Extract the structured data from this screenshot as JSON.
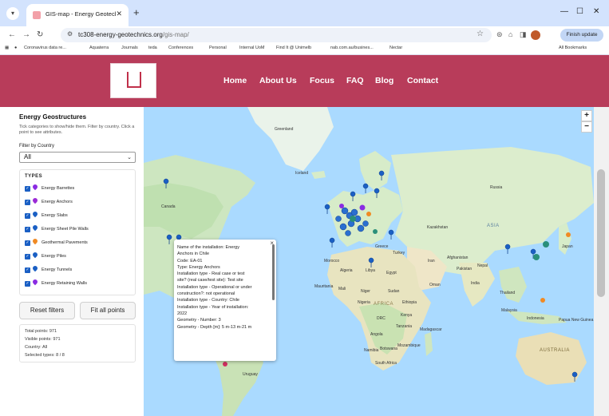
{
  "browser": {
    "tab_title": "GIS-map - Energy Geotechnics",
    "url_host": "tc308-energy-geotechnics.org",
    "url_path": "/gis-map/",
    "finish_update_label": "Finish update",
    "bookmarks": [
      "Coronavirus data re...",
      "Aquaterra",
      "Journals",
      "teda",
      "Conferences",
      "Personal",
      "Internal UoM",
      "Find It @ Unimelb",
      "nab.com.au/busines...",
      "Nectar"
    ],
    "all_bookmarks_label": "All Bookmarks"
  },
  "site": {
    "nav": [
      "Home",
      "About Us",
      "Focus",
      "FAQ",
      "Blog",
      "Contact"
    ],
    "header_color": "#b83c5a"
  },
  "sidebar": {
    "title": "Energy Geostructures",
    "help": "Tick categories to show/hide them. Filter by country. Click a point to see attributes.",
    "filter_label": "Filter by Country",
    "filter_value": "All",
    "types_heading": "TYPES",
    "types": [
      {
        "label": "Energy Barrettes",
        "color": "#8a2be2"
      },
      {
        "label": "Energy Anchors",
        "color": "#9b2bd6"
      },
      {
        "label": "Energy Slabs",
        "color": "#1a5fc4"
      },
      {
        "label": "Energy Sheet Pile Walls",
        "color": "#1a5fc4"
      },
      {
        "label": "Geothermal Pavements",
        "color": "#f08a24"
      },
      {
        "label": "Energy Piles",
        "color": "#1a5fc4"
      },
      {
        "label": "Energy Tunnels",
        "color": "#1a5fc4"
      },
      {
        "label": "Energy Retaining Walls",
        "color": "#8a2be2"
      }
    ],
    "reset_label": "Reset filters",
    "fit_label": "Fit all points",
    "stats": {
      "total": "Total points: 971",
      "visible": "Visible points: 971",
      "country": "Country: All",
      "selected": "Selected types: 8 / 8"
    }
  },
  "map": {
    "zoom_in": "+",
    "zoom_out": "−",
    "labels": {
      "greenland": "Greenland",
      "iceland": "Iceland",
      "canada": "Canada",
      "russia": "Russia",
      "kazakhstan": "Kazakhstan",
      "asia": "ASIA",
      "turkey": "Turkey",
      "iran": "Iran",
      "afghanistan": "Afghanistan",
      "pakistan": "Pakistan",
      "india": "India",
      "nepal": "Nepal",
      "morocco": "Morocco",
      "algeria": "Algeria",
      "libya": "Libya",
      "egypt": "Egypt",
      "mauritania": "Mauritania",
      "mali": "Mali",
      "niger": "Niger",
      "sudan": "Sudan",
      "africa": "AFRICA",
      "ethiopia": "Ethiopia",
      "nigeria": "Nigeria",
      "drc": "DRC",
      "kenya": "Kenya",
      "tanzania": "Tanzania",
      "angola": "Angola",
      "mozambique": "Mozambique",
      "namibia": "Namibia",
      "botswana": "Botswana",
      "south_africa": "South Africa",
      "madagascar": "Madagascar",
      "thailand": "Thailand",
      "malaysia": "Malaysia",
      "indonesia": "Indonesia",
      "papua": "Papua New Guinea",
      "australia": "AUSTRALIA",
      "uruguay": "Uruguay",
      "japan": "Japan",
      "oman": "Oman",
      "greece": "Greece"
    },
    "popup": [
      "Name of the installation: Energy",
      "Anchors in Chile",
      "Code: EA-01",
      "Type: Energy Anchors",
      "Installation type - Real case or test",
      "site? (real case/test site): Test site",
      "Installation type - Operational or under",
      "construction?: not operational",
      "Installation type - Country: Chile",
      "Installation type - Year of installation:",
      "2022",
      "Geometry - Number: 3",
      "Geometry - Depth [m]: 5 m-13 m-21 m"
    ]
  }
}
